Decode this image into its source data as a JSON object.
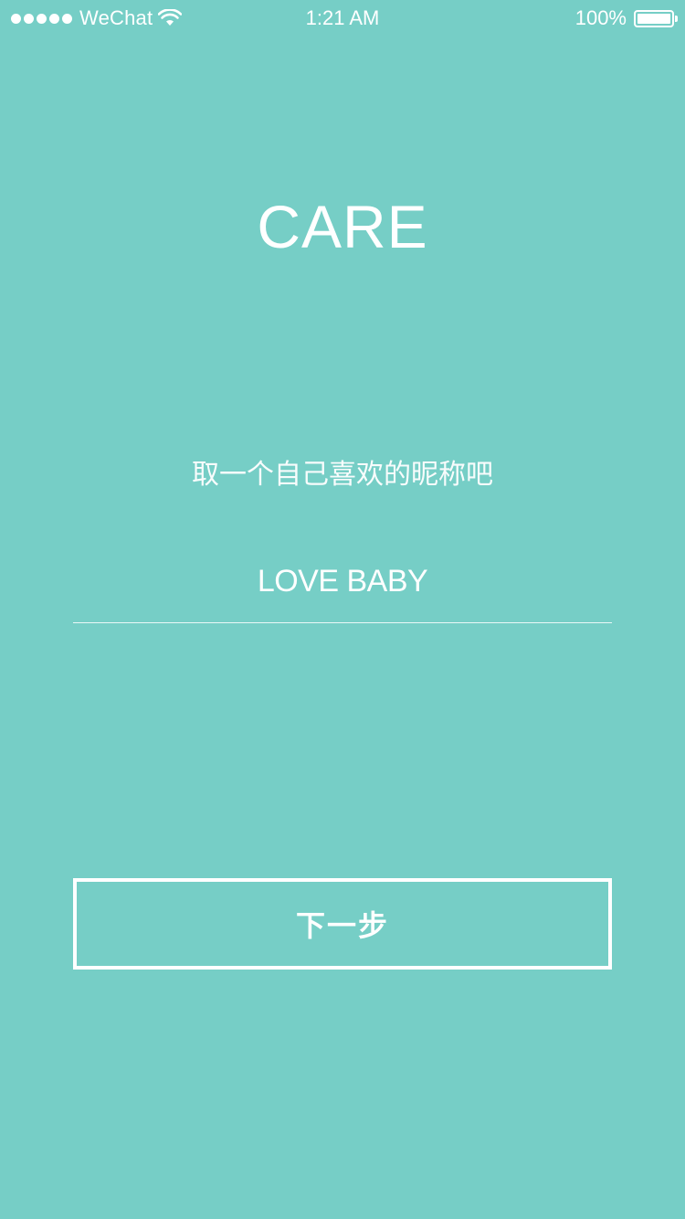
{
  "status_bar": {
    "carrier": "WeChat",
    "time": "1:21 AM",
    "battery_percent": "100%",
    "battery_level": 1.0,
    "signal_bars": 5,
    "wifi_icon": "wifi-icon"
  },
  "main": {
    "title": "CARE",
    "prompt": "取一个自己喜欢的昵称吧",
    "nickname_value": "LOVE BABY",
    "next_label": "下一步"
  },
  "colors": {
    "background": "#76CEC6",
    "foreground": "#FFFFFF"
  }
}
